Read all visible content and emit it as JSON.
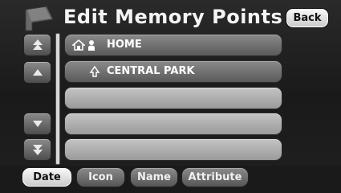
{
  "header": {
    "title": "Edit Memory Points",
    "back_label": "Back",
    "flag_icon": "flag-icon"
  },
  "scroll": {
    "page_up_icon": "page-up-icon",
    "line_up_icon": "line-up-icon",
    "line_down_icon": "line-down-icon",
    "page_down_icon": "page-down-icon"
  },
  "list": {
    "items": [
      {
        "label": "HOME",
        "icons": [
          "house-icon",
          "person-icon"
        ]
      },
      {
        "label": "CENTRAL PARK",
        "icons": [
          "tree-icon"
        ]
      },
      {
        "label": ""
      },
      {
        "label": ""
      },
      {
        "label": ""
      }
    ]
  },
  "sort": {
    "buttons": [
      {
        "label": "Date",
        "active": true
      },
      {
        "label": "Icon",
        "active": false
      },
      {
        "label": "Name",
        "active": false
      },
      {
        "label": "Attribute",
        "active": false
      }
    ]
  },
  "colors": {
    "background": "#1e1e1e",
    "title_text": "#f4f4f4",
    "row_fill": "#6f6f6f",
    "row_empty": "#b0b0b0",
    "active_button": "#e8e8e8"
  }
}
